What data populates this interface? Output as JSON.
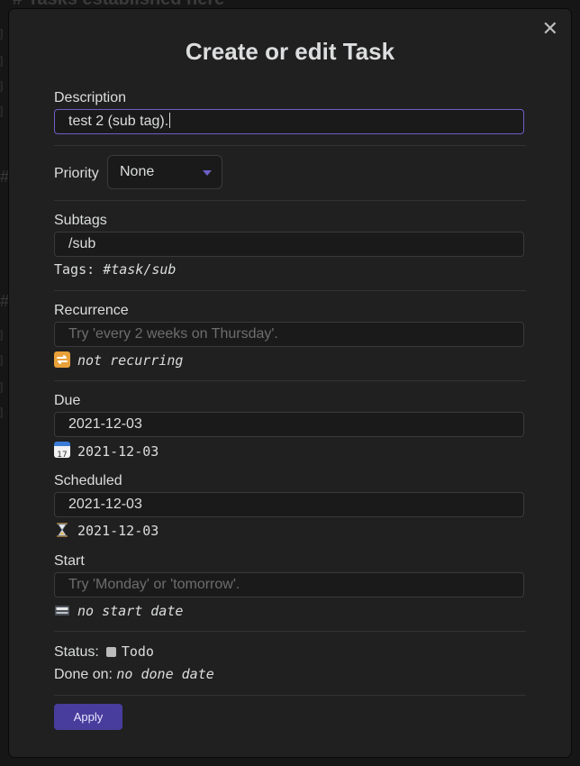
{
  "background": {
    "heading": "# Tasks established here"
  },
  "modal": {
    "title": "Create or edit Task",
    "close_glyph": "✕",
    "description": {
      "label": "Description",
      "value": "test 2 (sub tag)."
    },
    "priority": {
      "label": "Priority",
      "selected": "None"
    },
    "subtags": {
      "label": "Subtags",
      "value": "/sub",
      "tags_prefix": "Tags:",
      "tags_value": "#task/sub"
    },
    "recurrence": {
      "label": "Recurrence",
      "placeholder": "Try 'every 2 weeks on Thursday'.",
      "icon": "repeat-icon",
      "info": "not recurring"
    },
    "due": {
      "label": "Due",
      "value": "2021-12-03",
      "icon": "calendar-icon",
      "info": "2021-12-03"
    },
    "scheduled": {
      "label": "Scheduled",
      "value": "2021-12-03",
      "icon": "hourglass-icon",
      "info": "2021-12-03"
    },
    "start": {
      "label": "Start",
      "placeholder": "Try 'Monday' or 'tomorrow'.",
      "icon": "departure-icon",
      "info": "no start date"
    },
    "status": {
      "label": "Status:",
      "value": "Todo"
    },
    "done_on": {
      "label": "Done on:",
      "value": "no done date"
    },
    "apply_label": "Apply"
  },
  "colors": {
    "accent": "#6c5fc7",
    "button": "#483d9c",
    "modal_bg": "#202020"
  }
}
